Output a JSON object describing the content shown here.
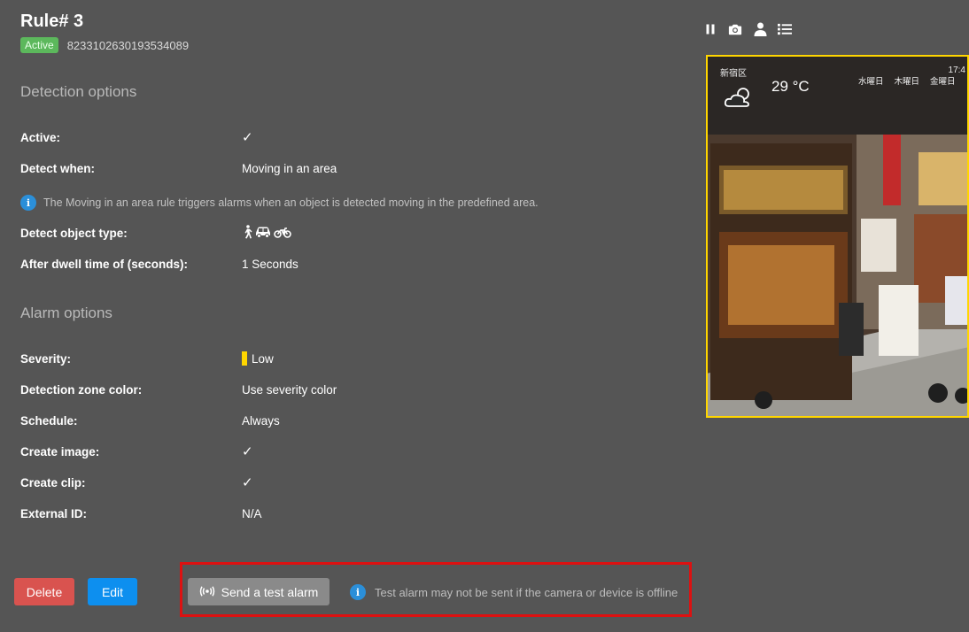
{
  "rule": {
    "title": "Rule# 3",
    "status": "Active",
    "id": "8233102630193534089"
  },
  "detection": {
    "heading": "Detection options",
    "active_label": "Active:",
    "detect_when_label": "Detect when:",
    "detect_when_value": "Moving in an area",
    "info_text": "The Moving in an area rule triggers alarms when an object is detected moving in the predefined area.",
    "object_type_label": "Detect object type:",
    "object_types": [
      "person-icon",
      "car-icon",
      "motorcycle-icon"
    ],
    "dwell_label": "After dwell time of (seconds):",
    "dwell_value": "1 Seconds"
  },
  "alarm": {
    "heading": "Alarm options",
    "severity_label": "Severity:",
    "severity_value": "Low",
    "severity_color": "#ffd600",
    "zone_color_label": "Detection zone color:",
    "zone_color_value": "Use severity color",
    "schedule_label": "Schedule:",
    "schedule_value": "Always",
    "create_image_label": "Create image:",
    "create_clip_label": "Create clip:",
    "external_id_label": "External ID:",
    "external_id_value": "N/A"
  },
  "camera": {
    "area_name": "新宿区",
    "temperature": "29 °C",
    "clock": "17:4",
    "forecast_days": [
      "水曜日",
      "木曜日",
      "金曜日"
    ]
  },
  "actions": {
    "delete_label": "Delete",
    "edit_label": "Edit",
    "test_alarm_label": "Send a test alarm",
    "test_alarm_note": "Test alarm may not be sent if the camera or device is offline"
  },
  "toolbar": [
    "pause-icon",
    "camera-icon",
    "person-icon",
    "list-icon"
  ]
}
